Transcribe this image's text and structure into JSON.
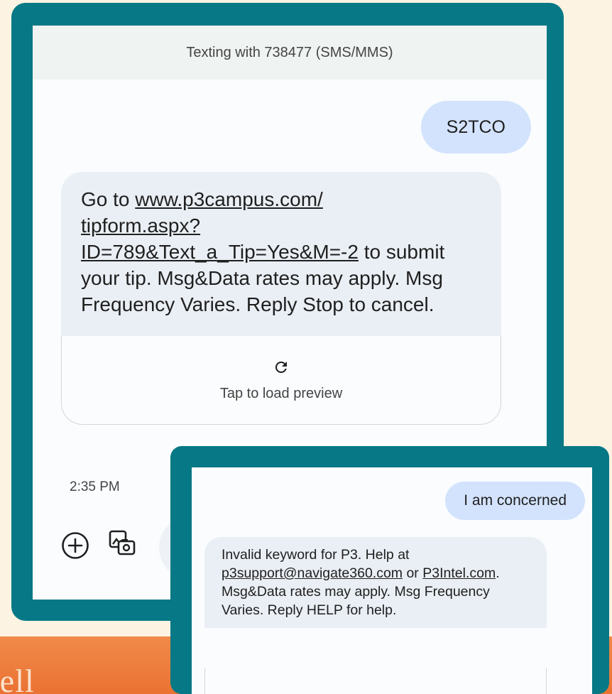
{
  "brand": {
    "logo_text": "tell"
  },
  "conversation": {
    "header": "Texting with 738477 (SMS/MMS)",
    "outgoing_message": "S2TCO",
    "incoming_message": {
      "prefix": "Go to ",
      "link_line1": "www.p3campus.com/",
      "link_line2": "tipform.aspx?",
      "link_line3": "ID=789&Text_a_Tip=Yes&M=-2",
      "suffix": " to submit your tip. Msg&Data rates may apply. Msg Frequency Varies. Reply Stop to cancel."
    },
    "preview": {
      "label": "Tap to load preview",
      "icon": "reload-icon"
    },
    "timestamp": "2:35 PM",
    "compose": {
      "add_icon": "plus-circle-icon",
      "gallery_icon": "gallery-camera-icon"
    }
  },
  "inset": {
    "outgoing_message": "I am concerned",
    "incoming_message": {
      "prefix": "Invalid keyword for P3. Help at ",
      "email": "p3support@navigate360.com",
      "mid": " or ",
      "site": "P3Intel.com",
      "suffix": ". Msg&Data rates may apply. Msg Frequency Varies. Reply HELP for help."
    }
  },
  "colors": {
    "frame": "#077885",
    "outgoing_bubble": "#d3e3fd",
    "incoming_bubble": "#eaeff5",
    "page_background": "#fdf3e3",
    "orange_band": "#ea7232"
  }
}
